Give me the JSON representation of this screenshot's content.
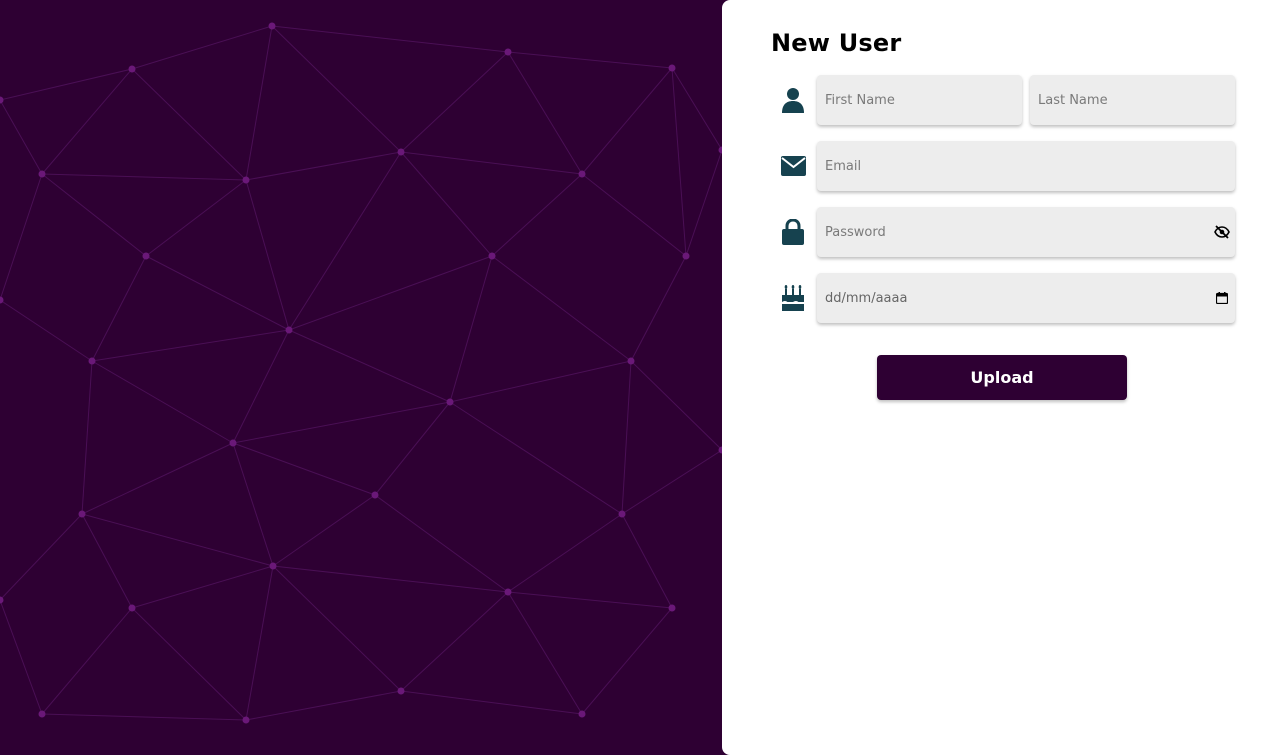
{
  "colors": {
    "background": "#2e0033",
    "pattern_line": "#4a0f55",
    "pattern_dot": "#6a1878",
    "panel": "#ffffff",
    "field": "#ededed",
    "icon": "#16424f",
    "button": "#2e0033",
    "button_text": "#ffffff"
  },
  "form": {
    "title": "New User",
    "first_name": {
      "placeholder": "First Name",
      "icon": "user-icon"
    },
    "last_name": {
      "placeholder": "Last Name"
    },
    "email": {
      "placeholder": "Email",
      "icon": "envelope-icon"
    },
    "password": {
      "placeholder": "Password",
      "icon": "lock-icon",
      "toggle_icon": "eye-slash-icon"
    },
    "birthdate": {
      "placeholder": "dd/mm/aaaa",
      "icon": "birthday-cake-icon",
      "picker_icon": "calendar-icon"
    },
    "submit_label": "Upload"
  }
}
